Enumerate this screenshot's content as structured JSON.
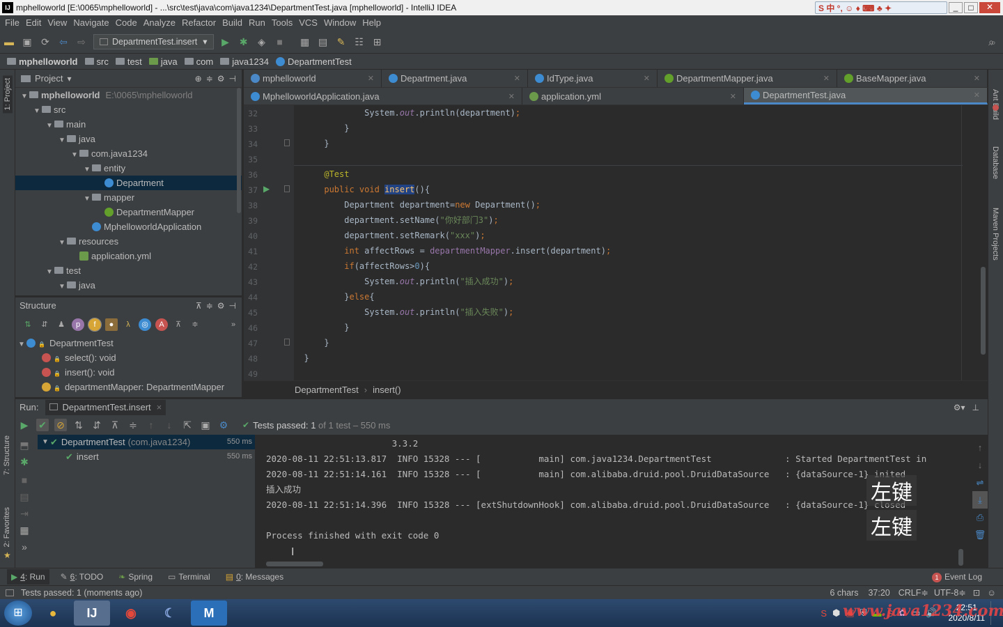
{
  "window": {
    "title": "mphelloworld [E:\\0065\\mphelloworld] - ...\\src\\test\\java\\com\\java1234\\DepartmentTest.java [mphelloworld] - IntelliJ IDEA",
    "app_icon": "IJ"
  },
  "menu": [
    "File",
    "Edit",
    "View",
    "Navigate",
    "Code",
    "Analyze",
    "Refactor",
    "Build",
    "Run",
    "Tools",
    "VCS",
    "Window",
    "Help"
  ],
  "toolbar": {
    "run_config": "DepartmentTest.insert"
  },
  "breadcrumbs": [
    "mphelloworld",
    "src",
    "test",
    "java",
    "com",
    "java1234",
    "DepartmentTest"
  ],
  "project": {
    "header": "Project",
    "tree": [
      {
        "label": "mphelloworld",
        "extra": "E:\\0065\\mphelloworld",
        "depth": 0,
        "icon": "folder",
        "arrow": "▼",
        "bold": true
      },
      {
        "label": "src",
        "depth": 1,
        "icon": "folder",
        "arrow": "▼"
      },
      {
        "label": "main",
        "depth": 2,
        "icon": "folder",
        "arrow": "▼"
      },
      {
        "label": "java",
        "depth": 3,
        "icon": "folder",
        "arrow": "▼"
      },
      {
        "label": "com.java1234",
        "depth": 4,
        "icon": "folder",
        "arrow": "▼"
      },
      {
        "label": "entity",
        "depth": 5,
        "icon": "folder",
        "arrow": "▼"
      },
      {
        "label": "Department",
        "depth": 6,
        "icon": "class",
        "arrow": "",
        "selected": true
      },
      {
        "label": "mapper",
        "depth": 5,
        "icon": "folder",
        "arrow": "▼"
      },
      {
        "label": "DepartmentMapper",
        "depth": 6,
        "icon": "interface",
        "arrow": ""
      },
      {
        "label": "MphelloworldApplication",
        "depth": 5,
        "icon": "class",
        "arrow": ""
      },
      {
        "label": "resources",
        "depth": 3,
        "icon": "folder",
        "arrow": "▼"
      },
      {
        "label": "application.yml",
        "depth": 4,
        "icon": "yml",
        "arrow": ""
      },
      {
        "label": "test",
        "depth": 2,
        "icon": "folder",
        "arrow": "▼"
      },
      {
        "label": "java",
        "depth": 3,
        "icon": "folder",
        "arrow": "▼"
      }
    ]
  },
  "structure": {
    "header": "Structure",
    "items": [
      {
        "label": "DepartmentTest",
        "depth": 0,
        "icon": "class-icon"
      },
      {
        "label": "select(): void",
        "depth": 1,
        "icon": "method-icon"
      },
      {
        "label": "insert(): void",
        "depth": 1,
        "icon": "method-icon"
      },
      {
        "label": "departmentMapper: DepartmentMapper",
        "depth": 1,
        "icon": "field-icon"
      }
    ]
  },
  "tabs_row1": [
    {
      "label": "mphelloworld",
      "icon": "m"
    },
    {
      "label": "Department.java",
      "icon": "c"
    },
    {
      "label": "IdType.java",
      "icon": "e"
    },
    {
      "label": "DepartmentMapper.java",
      "icon": "i"
    },
    {
      "label": "BaseMapper.java",
      "icon": "i"
    }
  ],
  "tabs_row2": [
    {
      "label": "MphelloworldApplication.java",
      "icon": "c"
    },
    {
      "label": "application.yml",
      "icon": "y"
    },
    {
      "label": "DepartmentTest.java",
      "icon": "c",
      "active": true
    }
  ],
  "code": {
    "line_numbers": [
      "32",
      "33",
      "34",
      "35",
      "36",
      "37",
      "38",
      "39",
      "40",
      "41",
      "42",
      "43",
      "44",
      "45",
      "46",
      "47",
      "48",
      "49"
    ]
  },
  "editor_breadcrumb": [
    "DepartmentTest",
    "insert()"
  ],
  "run": {
    "label": "Run:",
    "config": "DepartmentTest.insert",
    "tests_passed": "Tests passed:",
    "tests_count": "1",
    "tests_of": "of 1 test – 550 ms",
    "tree": [
      {
        "label": "DepartmentTest",
        "extra": "(com.java1234)",
        "time": "550 ms"
      },
      {
        "label": "insert",
        "extra": "",
        "time": "550 ms"
      }
    ],
    "console": [
      "                        3.3.2",
      "2020-08-11 22:51:13.817  INFO 15328 --- [           main] com.java1234.DepartmentTest              : Started DepartmentTest in",
      "2020-08-11 22:51:14.161  INFO 15328 --- [           main] com.alibaba.druid.pool.DruidDataSource   : {dataSource-1} inited",
      "插入成功",
      "2020-08-11 22:51:14.396  INFO 15328 --- [extShutdownHook] com.alibaba.druid.pool.DruidDataSource   : {dataSource-1} closed",
      "",
      "Process finished with exit code 0"
    ],
    "overlay_text": [
      "左键",
      "左键"
    ]
  },
  "bottom_tabs": [
    {
      "num": "4",
      "label": ": Run",
      "active": true
    },
    {
      "num": "6",
      "label": ": TODO"
    },
    {
      "num": "",
      "label": "Spring"
    },
    {
      "num": "",
      "label": "Terminal"
    },
    {
      "num": "0",
      "label": ": Messages"
    }
  ],
  "event_log": "Event Log",
  "event_badge": "1",
  "status": {
    "message": "Tests passed: 1 (moments ago)",
    "chars": "6 chars",
    "position": "37:20",
    "line_sep": "CRLF≑",
    "encoding": "UTF-8≑"
  },
  "side_tools": {
    "left": [
      "1: Project",
      "7: Structure",
      "2: Favorites"
    ],
    "right": [
      "Ant Build",
      "Database",
      "Maven Projects"
    ]
  },
  "clock": {
    "time": "22:51",
    "date": "2020/8/11"
  },
  "watermark": "www.java1234.com"
}
